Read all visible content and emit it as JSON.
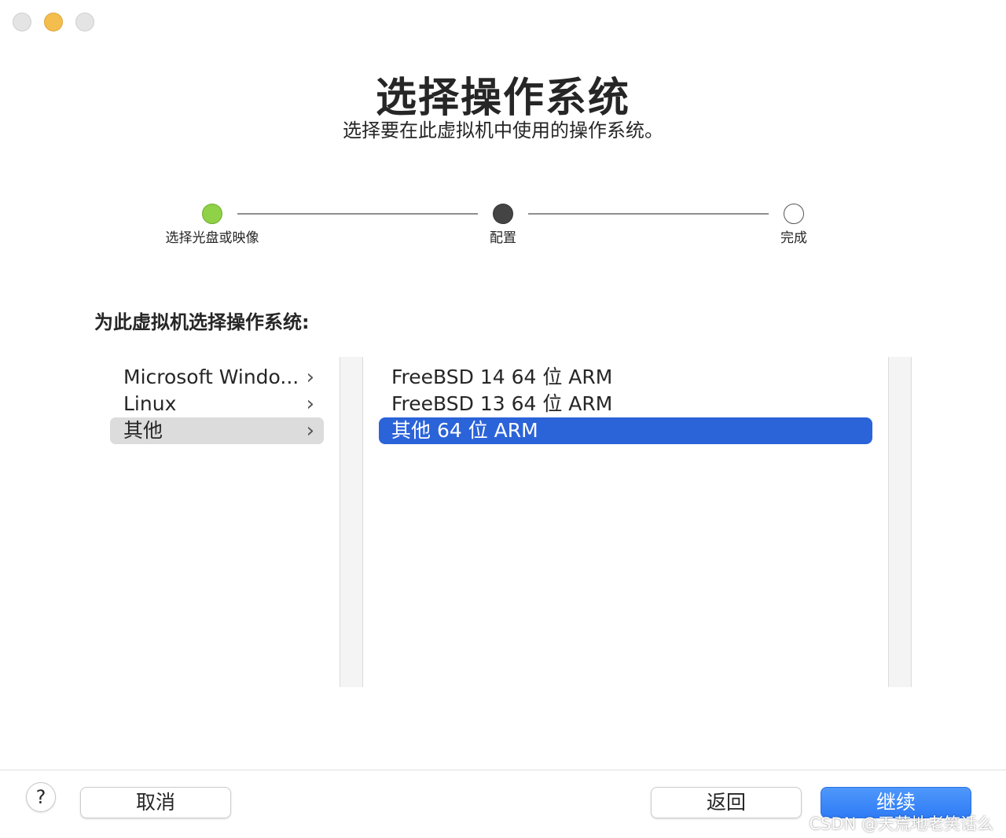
{
  "window": {
    "title": "选择操作系统",
    "subtitle": "选择要在此虚拟机中使用的操作系统。"
  },
  "steps": [
    {
      "label": "选择光盘或映像",
      "state": "complete",
      "color": "#8fd147"
    },
    {
      "label": "配置",
      "state": "current",
      "color": "#444444"
    },
    {
      "label": "完成",
      "state": "pending",
      "color": "#ffffff"
    }
  ],
  "section_label": "为此虚拟机选择操作系统:",
  "categories": [
    {
      "label": "Microsoft Windo...",
      "selected": false
    },
    {
      "label": "Linux",
      "selected": false
    },
    {
      "label": "其他",
      "selected": true
    }
  ],
  "chevron": "›",
  "os_options": [
    {
      "label": "FreeBSD 14 64 位 ARM",
      "selected": false
    },
    {
      "label": "FreeBSD 13 64 位 ARM",
      "selected": false
    },
    {
      "label": "其他 64 位 ARM",
      "selected": true
    }
  ],
  "buttons": {
    "help": "?",
    "cancel": "取消",
    "back": "返回",
    "continue": "继续"
  },
  "watermark": "CSDN @天荒地老笑话么",
  "colors": {
    "accent": "#2b63d9",
    "primary_button": "#3a86f9",
    "step_complete": "#8fd147"
  }
}
